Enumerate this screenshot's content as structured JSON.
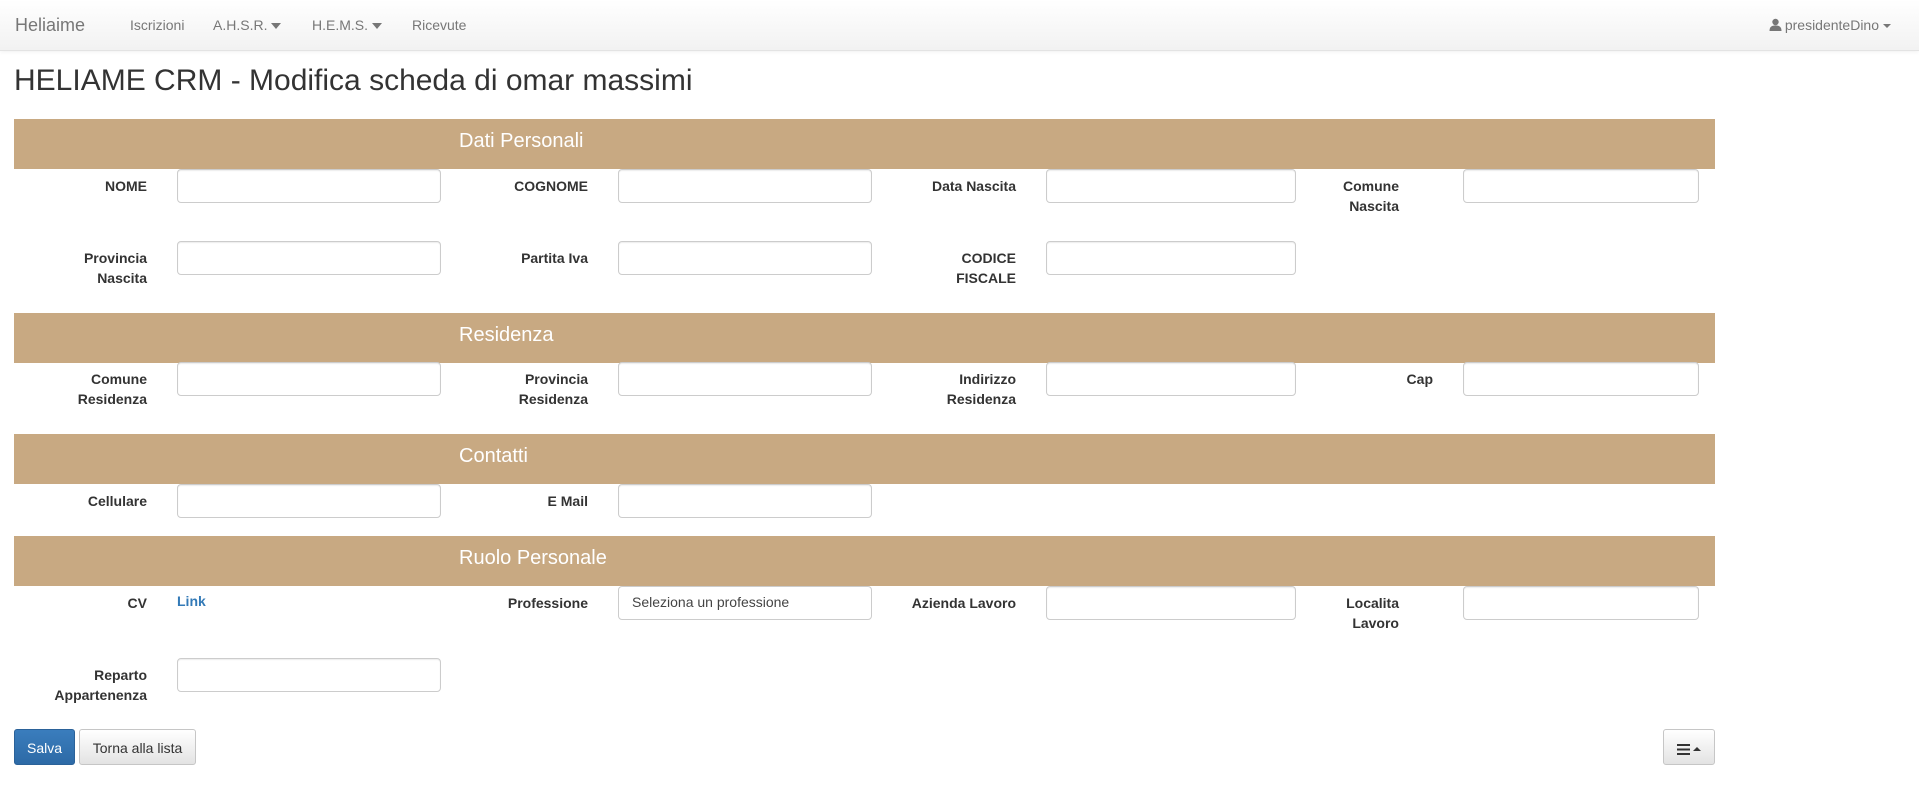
{
  "navbar": {
    "brand": "Heliaime",
    "items": [
      {
        "label": "Iscrizioni"
      },
      {
        "label": "A.H.S.R."
      },
      {
        "label": "H.E.M.S."
      },
      {
        "label": "Ricevute"
      }
    ],
    "user": "presidenteDino",
    "user_icon": "user-icon"
  },
  "page": {
    "title": "HELIAME CRM - Modifica scheda di omar massimi"
  },
  "sections": {
    "dati_personali": {
      "title": "Dati Personali",
      "fields": {
        "nome": {
          "label": "NOME",
          "value": ""
        },
        "cognome": {
          "label": "COGNOME",
          "value": ""
        },
        "data_nascita": {
          "label": "Data Nascita",
          "value": ""
        },
        "comune_nascita": {
          "label": "Comune Nascita",
          "value": ""
        },
        "provincia_nascita": {
          "label": "Provincia Nascita",
          "value": ""
        },
        "partita_iva": {
          "label": "Partita Iva",
          "value": ""
        },
        "codice_fiscale": {
          "label": "CODICE FISCALE",
          "value": ""
        }
      }
    },
    "residenza": {
      "title": "Residenza",
      "fields": {
        "comune_residenza": {
          "label": "Comune Residenza",
          "value": ""
        },
        "provincia_residenza": {
          "label": "Provincia Residenza",
          "value": ""
        },
        "indirizzo_residenza": {
          "label": "Indirizzo Residenza",
          "value": ""
        },
        "cap": {
          "label": "Cap",
          "value": ""
        }
      }
    },
    "contatti": {
      "title": "Contatti",
      "fields": {
        "cellulare": {
          "label": "Cellulare",
          "value": ""
        },
        "email": {
          "label": "E Mail",
          "value": ""
        }
      }
    },
    "ruolo_personale": {
      "title": "Ruolo Personale",
      "fields": {
        "cv": {
          "label": "CV",
          "link": "Link"
        },
        "professione": {
          "label": "Professione",
          "selected": "Seleziona un professione"
        },
        "azienda_lavoro": {
          "label": "Azienda Lavoro",
          "value": ""
        },
        "localita_lavoro": {
          "label": "Localita Lavoro",
          "value": ""
        },
        "reparto_appartenenza": {
          "label": "Reparto Appartenenza",
          "value": ""
        }
      }
    }
  },
  "actions": {
    "save": "Salva",
    "back": "Torna alla lista",
    "menu_icon": "bars-icon"
  },
  "colors": {
    "section_bar": "#c8a982",
    "primary": "#337ab7",
    "link": "#337ab7"
  }
}
